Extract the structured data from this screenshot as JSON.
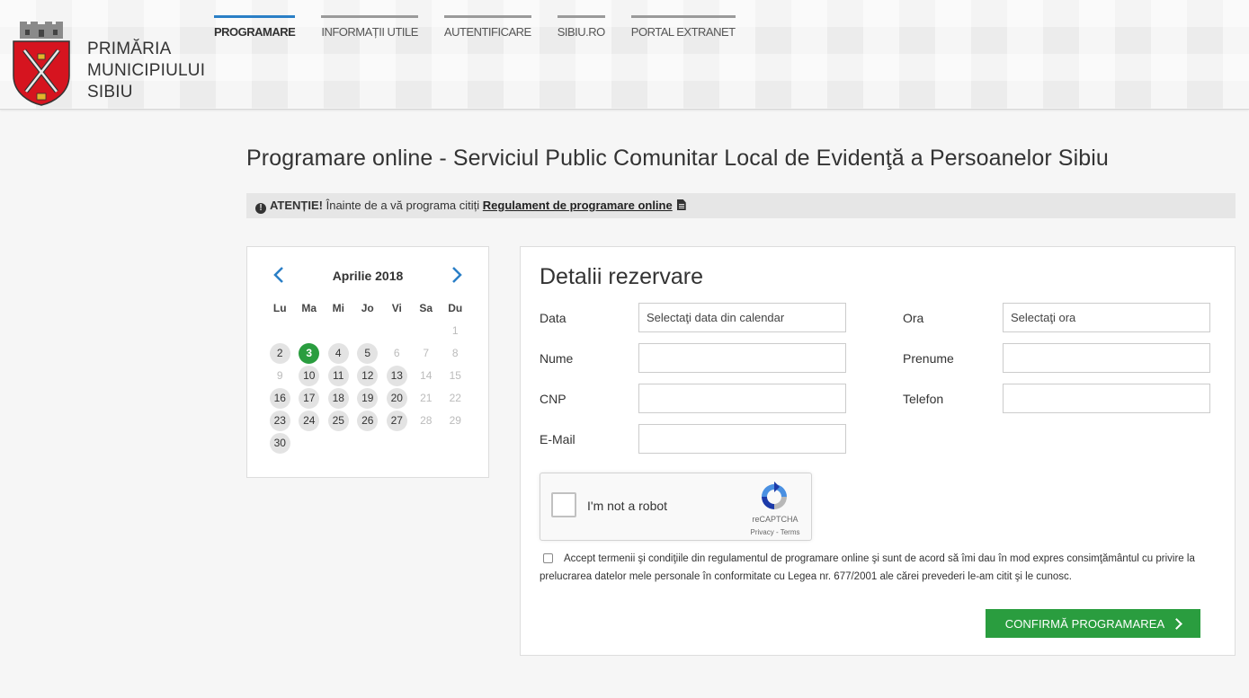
{
  "header": {
    "brand_lines": [
      "PRIMĂRIA",
      "MUNICIPIULUI",
      "SIBIU"
    ],
    "nav": [
      {
        "label": "PROGRAMARE",
        "active": true
      },
      {
        "label": "INFORMAȚII UTILE",
        "active": false
      },
      {
        "label": "AUTENTIFICARE",
        "active": false
      },
      {
        "label": "SIBIU.RO",
        "active": false
      },
      {
        "label": "PORTAL EXTRANET",
        "active": false
      }
    ]
  },
  "page": {
    "title": "Programare online - Serviciul Public Comunitar Local de Evidenţă a Persoanelor Sibiu"
  },
  "notice": {
    "icon": "exclamation-circle-icon",
    "strong": "ATENȚIE!",
    "text": "Înainte de a vă programa citiți",
    "link": "Regulament de programare online",
    "link_icon": "file-text-icon"
  },
  "calendar": {
    "month": "Aprilie 2018",
    "weekdays": [
      "Lu",
      "Ma",
      "Mi",
      "Jo",
      "Vi",
      "Sa",
      "Du"
    ],
    "weeks": [
      [
        null,
        null,
        null,
        null,
        null,
        null,
        {
          "d": "1",
          "s": "disabled"
        }
      ],
      [
        {
          "d": "2",
          "s": "available"
        },
        {
          "d": "3",
          "s": "selected"
        },
        {
          "d": "4",
          "s": "available"
        },
        {
          "d": "5",
          "s": "available"
        },
        {
          "d": "6",
          "s": "disabled"
        },
        {
          "d": "7",
          "s": "disabled"
        },
        {
          "d": "8",
          "s": "disabled"
        }
      ],
      [
        {
          "d": "9",
          "s": "disabled"
        },
        {
          "d": "10",
          "s": "available"
        },
        {
          "d": "11",
          "s": "available"
        },
        {
          "d": "12",
          "s": "available"
        },
        {
          "d": "13",
          "s": "available"
        },
        {
          "d": "14",
          "s": "disabled"
        },
        {
          "d": "15",
          "s": "disabled"
        }
      ],
      [
        {
          "d": "16",
          "s": "available"
        },
        {
          "d": "17",
          "s": "available"
        },
        {
          "d": "18",
          "s": "available"
        },
        {
          "d": "19",
          "s": "available"
        },
        {
          "d": "20",
          "s": "available"
        },
        {
          "d": "21",
          "s": "disabled"
        },
        {
          "d": "22",
          "s": "disabled"
        }
      ],
      [
        {
          "d": "23",
          "s": "available"
        },
        {
          "d": "24",
          "s": "available"
        },
        {
          "d": "25",
          "s": "available"
        },
        {
          "d": "26",
          "s": "available"
        },
        {
          "d": "27",
          "s": "available"
        },
        {
          "d": "28",
          "s": "disabled"
        },
        {
          "d": "29",
          "s": "disabled"
        }
      ],
      [
        {
          "d": "30",
          "s": "available"
        },
        null,
        null,
        null,
        null,
        null,
        null
      ]
    ]
  },
  "form": {
    "title": "Detalii rezervare",
    "fields": [
      {
        "key": "data",
        "label": "Data",
        "value": "",
        "placeholder": "Selectaţi data din calendar"
      },
      {
        "key": "ora",
        "label": "Ora",
        "value": "",
        "placeholder": "Selectaţi ora"
      },
      {
        "key": "nume",
        "label": "Nume",
        "value": "",
        "placeholder": ""
      },
      {
        "key": "prenume",
        "label": "Prenume",
        "value": "",
        "placeholder": ""
      },
      {
        "key": "cnp",
        "label": "CNP",
        "value": "",
        "placeholder": ""
      },
      {
        "key": "telefon",
        "label": "Telefon",
        "value": "",
        "placeholder": ""
      },
      {
        "key": "email",
        "label": "E-Mail",
        "value": "",
        "placeholder": ""
      }
    ],
    "recaptcha": {
      "label": "I'm not a robot",
      "brand": "reCAPTCHA",
      "links": "Privacy - Terms"
    },
    "terms": "Accept termenii şi condiţiile din regulamentul de programare online şi sunt de acord să îmi dau în mod expres consimţământul cu privire la prelucrarea datelor mele personale în conformitate cu Legea nr. 677/2001 ale cărei prevederi le-am citit şi le cunosc.",
    "confirm_label": "CONFIRMĂ PROGRAMAREA"
  },
  "colors": {
    "accent_blue": "#2a7fc6",
    "success_green": "#2a9d3f",
    "crest_red": "#d6141f"
  }
}
